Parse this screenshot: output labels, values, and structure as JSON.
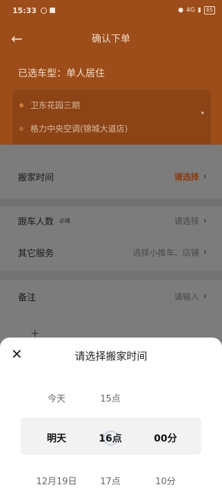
{
  "status_bar": {
    "time": "15:33",
    "network": "4G",
    "battery": "65"
  },
  "header": {
    "title": "确认下单"
  },
  "vehicle": {
    "text": "已选车型：单人居住"
  },
  "route": {
    "from": "卫东花园三期",
    "to": "格力中央空调(锦城大道店)"
  },
  "form": {
    "move_time": {
      "label": "搬家时间",
      "value": "请选择"
    },
    "riders": {
      "label": "跟车人数",
      "tag": "必填",
      "value": "请选择"
    },
    "services": {
      "label": "其它服务",
      "value": "选择小推车、店铺"
    },
    "note": {
      "label": "备注",
      "value": "请输入"
    }
  },
  "sheet": {
    "title": "请选择搬家时间",
    "close": "✕",
    "days": [
      "今天",
      "明天",
      "12月19日"
    ],
    "hours": [
      "15点",
      "16点",
      "17点"
    ],
    "minutes": [
      "",
      "00分",
      "10分"
    ]
  },
  "colors": {
    "accent": "#e8742a",
    "sheet_bg": "#ffffff"
  }
}
